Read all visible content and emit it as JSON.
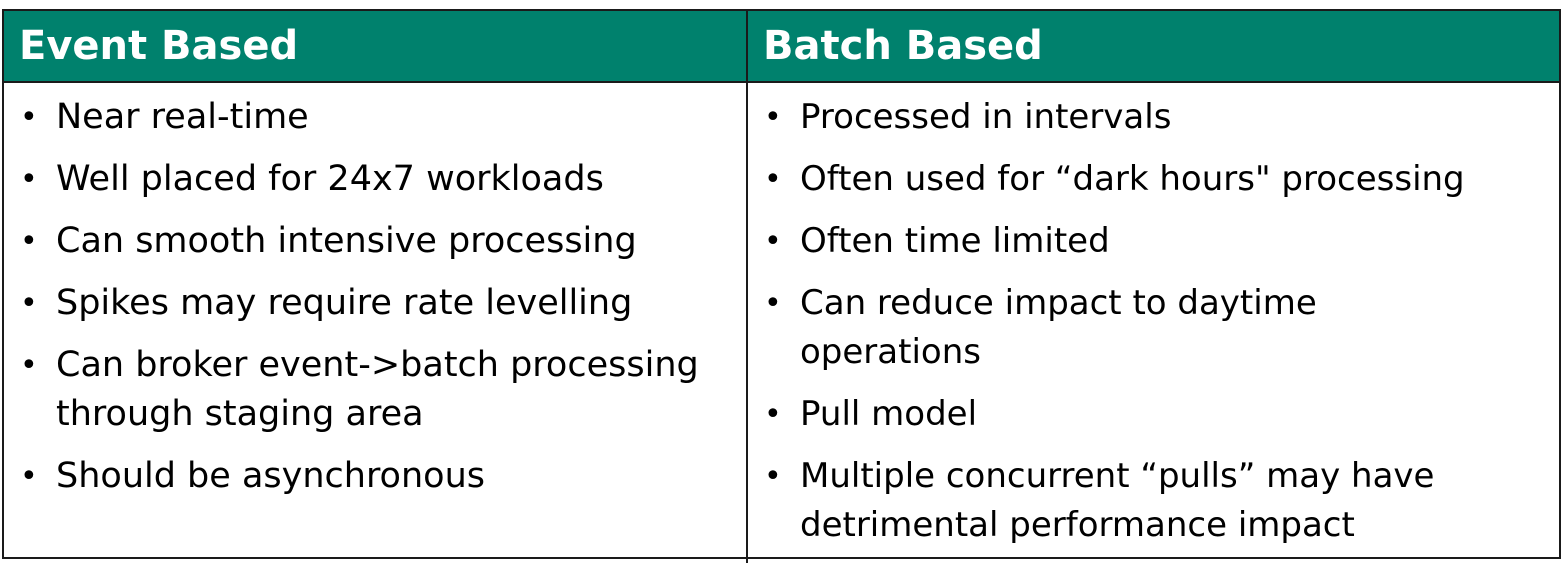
{
  "columns": [
    {
      "header": "Event Based",
      "items": [
        "Near real-time",
        "Well placed for 24x7 workloads",
        "Can smooth intensive processing",
        "Spikes may require rate levelling",
        "Can broker event->batch processing\nthrough staging area",
        "Should be asynchronous"
      ]
    },
    {
      "header": "Batch Based",
      "items": [
        "Processed in intervals",
        "Often used for “dark hours\" processing",
        "Often time limited",
        "Can reduce impact to daytime\noperations",
        "Pull model",
        "Multiple concurrent “pulls” may have\ndetrimental performance impact"
      ]
    }
  ],
  "colors": {
    "header_bg": "#00816d",
    "header_text": "#ffffff",
    "border": "#1a1a1a"
  },
  "icons": {
    "bullet": "•"
  }
}
